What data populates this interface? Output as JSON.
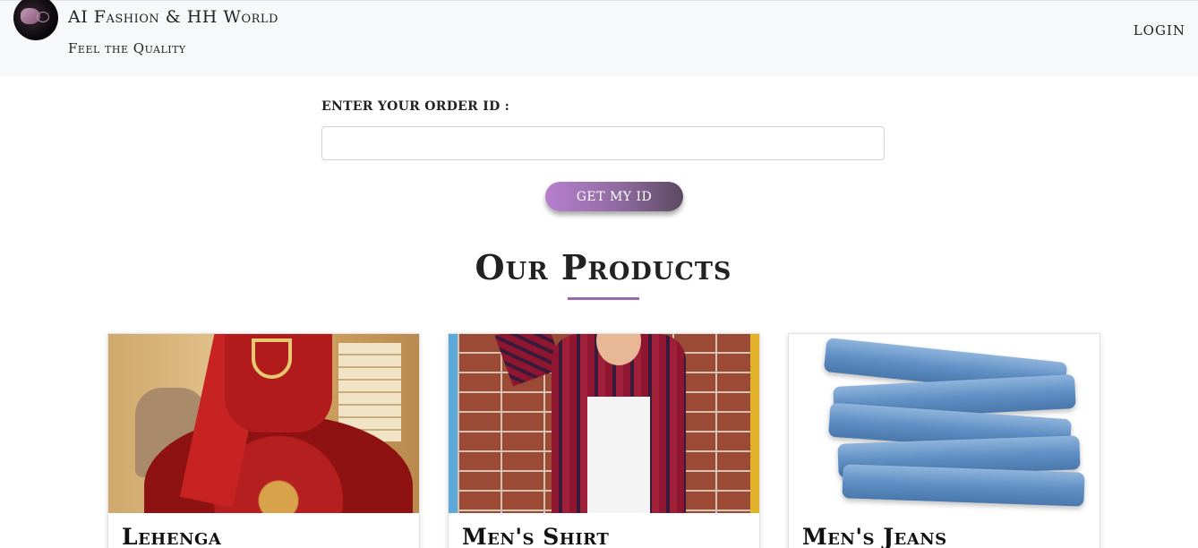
{
  "header": {
    "brand_title": "AI Fashion & HH World",
    "brand_tagline": "Feel the Quality",
    "login_label": "LOGIN"
  },
  "order": {
    "label": "ENTER YOUR ORDER ID :",
    "input_value": "",
    "input_placeholder": "",
    "button_label": "GET MY ID"
  },
  "products": {
    "title": "Our Products",
    "items": [
      {
        "name": "Lehenga",
        "image": "lehenga-photo"
      },
      {
        "name": "Men's Shirt",
        "image": "mens-shirt-photo"
      },
      {
        "name": "Men's Jeans",
        "image": "mens-jeans-photo"
      }
    ]
  },
  "colors": {
    "accent": "#9a6aad",
    "button_gradient_start": "#b77fcf",
    "button_gradient_end": "#5b4a62",
    "header_bg": "#f7f8fa"
  }
}
